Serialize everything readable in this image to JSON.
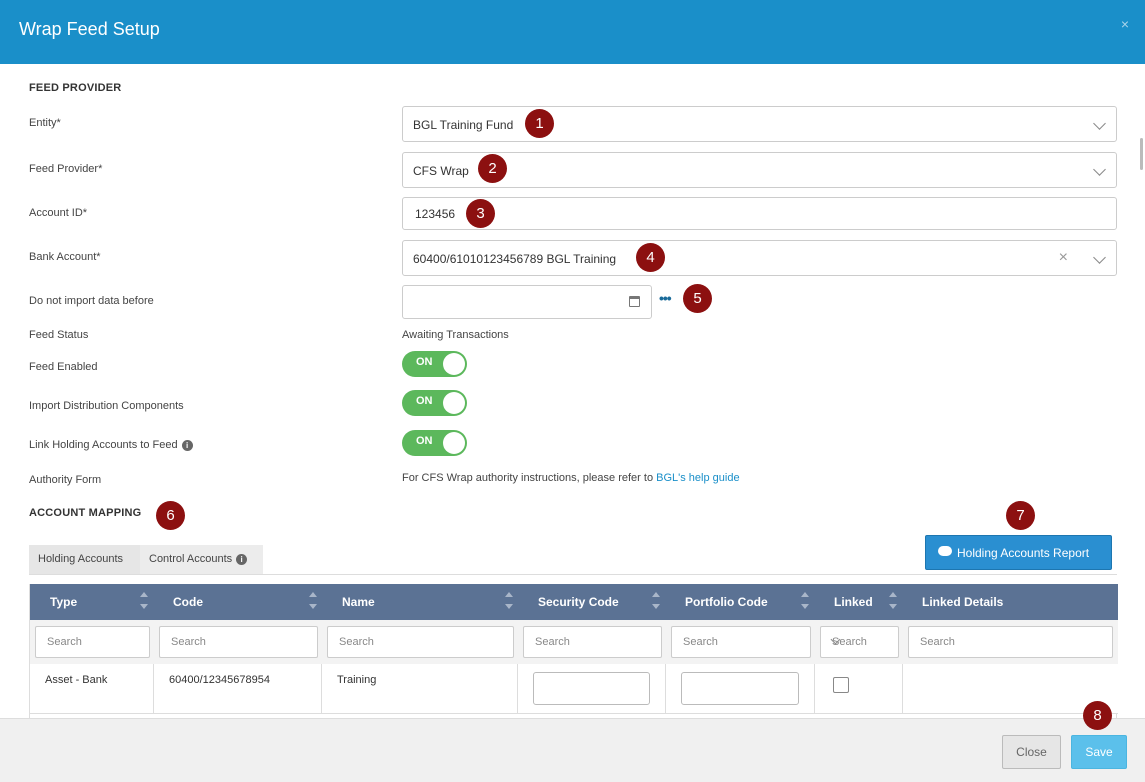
{
  "header": {
    "title": "Wrap Feed Setup",
    "close_label": "×"
  },
  "feed_provider": {
    "section_title": "FEED PROVIDER",
    "entity": {
      "label": "Entity*",
      "value": "BGL Training Fund"
    },
    "provider": {
      "label": "Feed Provider*",
      "value": "CFS Wrap"
    },
    "account_id": {
      "label": "Account ID*",
      "value": "123456"
    },
    "bank_account": {
      "label": "Bank Account*",
      "value": "60400/61010123456789 BGL Training",
      "clear": "×"
    },
    "do_not_import": {
      "label": "Do not import data before",
      "value": "",
      "more": "•••"
    },
    "feed_status": {
      "label": "Feed Status",
      "value": "Awaiting Transactions"
    },
    "feed_enabled": {
      "label": "Feed Enabled",
      "toggle": "ON"
    },
    "import_distribution": {
      "label": "Import Distribution Components",
      "toggle": "ON"
    },
    "link_holding": {
      "label": "Link Holding Accounts to Feed",
      "toggle": "ON"
    },
    "authority_form": {
      "label": "Authority Form",
      "text": "For CFS Wrap authority instructions, please refer to",
      "link": "BGL's help guide"
    }
  },
  "account_mapping": {
    "section_title": "ACCOUNT MAPPING",
    "tabs": [
      "Holding Accounts",
      "Control Accounts"
    ],
    "report_button": "Holding Accounts Report",
    "columns": [
      "Type",
      "Code",
      "Name",
      "Security Code",
      "Portfolio Code",
      "Linked",
      "Linked Details"
    ],
    "filter_placeholder": "Search",
    "rows": [
      {
        "type": "Asset - Bank",
        "code": "60400/12345678954",
        "name": "Training",
        "security_code": "",
        "portfolio_code": "",
        "linked": false,
        "linked_details": ""
      }
    ]
  },
  "badges": [
    "1",
    "2",
    "3",
    "4",
    "5",
    "6",
    "7",
    "8"
  ],
  "footer": {
    "close_label": "Close",
    "save_label": "Save"
  },
  "colors": {
    "header": "#1a8fc9",
    "table_header": "#5b7294",
    "toggle_on": "#5cb85c",
    "badge": "#8c1010",
    "save": "#5bc0eb"
  }
}
